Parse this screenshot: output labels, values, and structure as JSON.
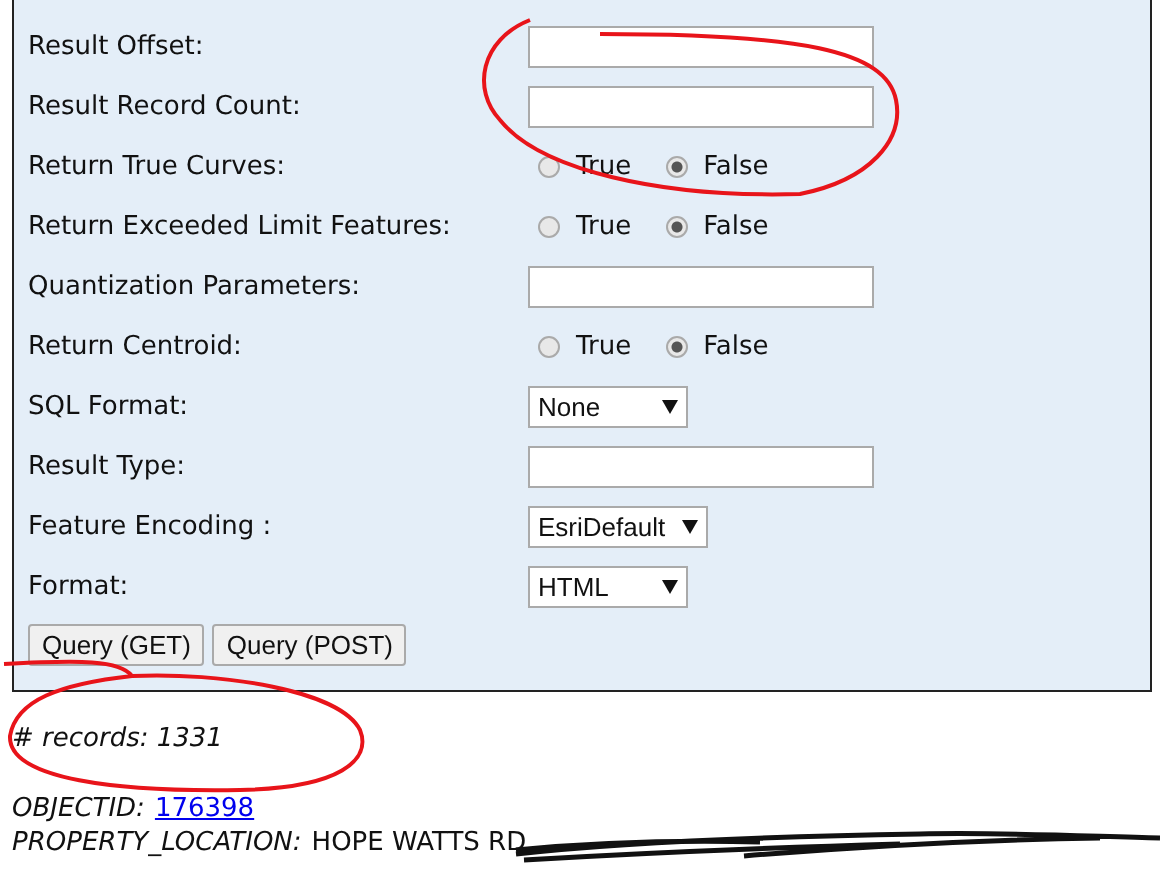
{
  "fields": [
    {
      "kind": "text",
      "label": "Result Offset:"
    },
    {
      "kind": "text",
      "label": "Result Record Count:"
    },
    {
      "kind": "radio",
      "label": "Return True Curves:",
      "options": [
        {
          "label": "True",
          "selected": false
        },
        {
          "label": "False",
          "selected": true
        }
      ]
    },
    {
      "kind": "radio",
      "label": "Return Exceeded Limit Features:",
      "options": [
        {
          "label": "True",
          "selected": false
        },
        {
          "label": "False",
          "selected": true
        }
      ]
    },
    {
      "kind": "text",
      "label": "Quantization Parameters:"
    },
    {
      "kind": "radio",
      "label": "Return Centroid:",
      "options": [
        {
          "label": "True",
          "selected": false
        },
        {
          "label": "False",
          "selected": true
        }
      ]
    },
    {
      "kind": "select",
      "label": "SQL Format:",
      "value": "None"
    },
    {
      "kind": "text",
      "label": "Result Type:"
    },
    {
      "kind": "select",
      "label": "Feature Encoding :",
      "value": "EsriDefault"
    },
    {
      "kind": "select",
      "label": "Format:",
      "value": "HTML"
    }
  ],
  "buttons": [
    "Query (GET)",
    "Query (POST)"
  ],
  "result": {
    "count_label": "# records: 1331",
    "records": [
      {
        "name": "OBJECTID:",
        "value": "176398",
        "kind": "link"
      },
      {
        "name": "PROPERTY_LOCATION:",
        "value": "HOPE WATTS RD",
        "kind": "text"
      }
    ]
  }
}
